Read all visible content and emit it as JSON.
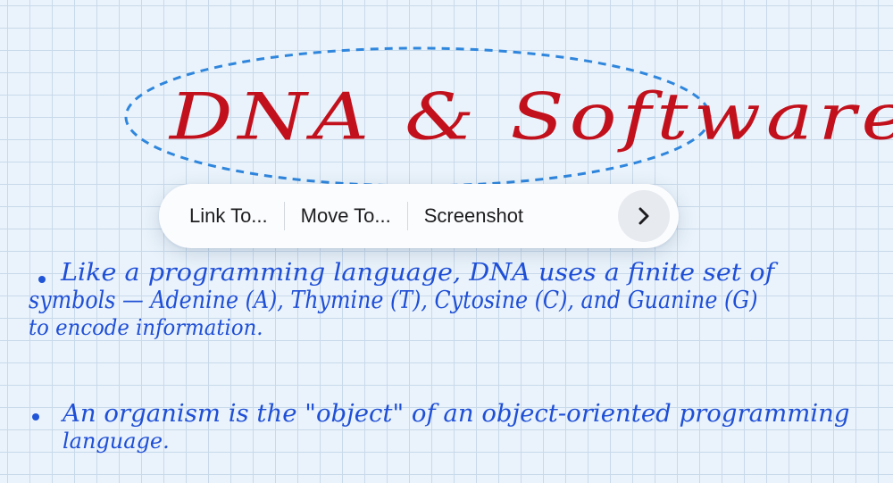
{
  "title": "DNA & Software",
  "context_menu": {
    "items": [
      "Link To...",
      "Move To...",
      "Screenshot"
    ],
    "more_icon": "chevron-right-icon"
  },
  "notes": {
    "bullet1": {
      "line1": "Like a programming language, DNA uses a finite set of",
      "line2": "symbols — Adenine (A), Thymine (T), Cytosine (C), and Guanine (G)",
      "line3": "to encode information."
    },
    "bullet2": {
      "line1": "An organism is the \"object\" of an object-oriented programming",
      "line2": "language."
    }
  },
  "colors": {
    "title": "#c2111c",
    "ink": "#1f4fd6",
    "lasso": "#2f86dd",
    "paper": "#eaf3fb",
    "grid": "#c8d9ea"
  }
}
